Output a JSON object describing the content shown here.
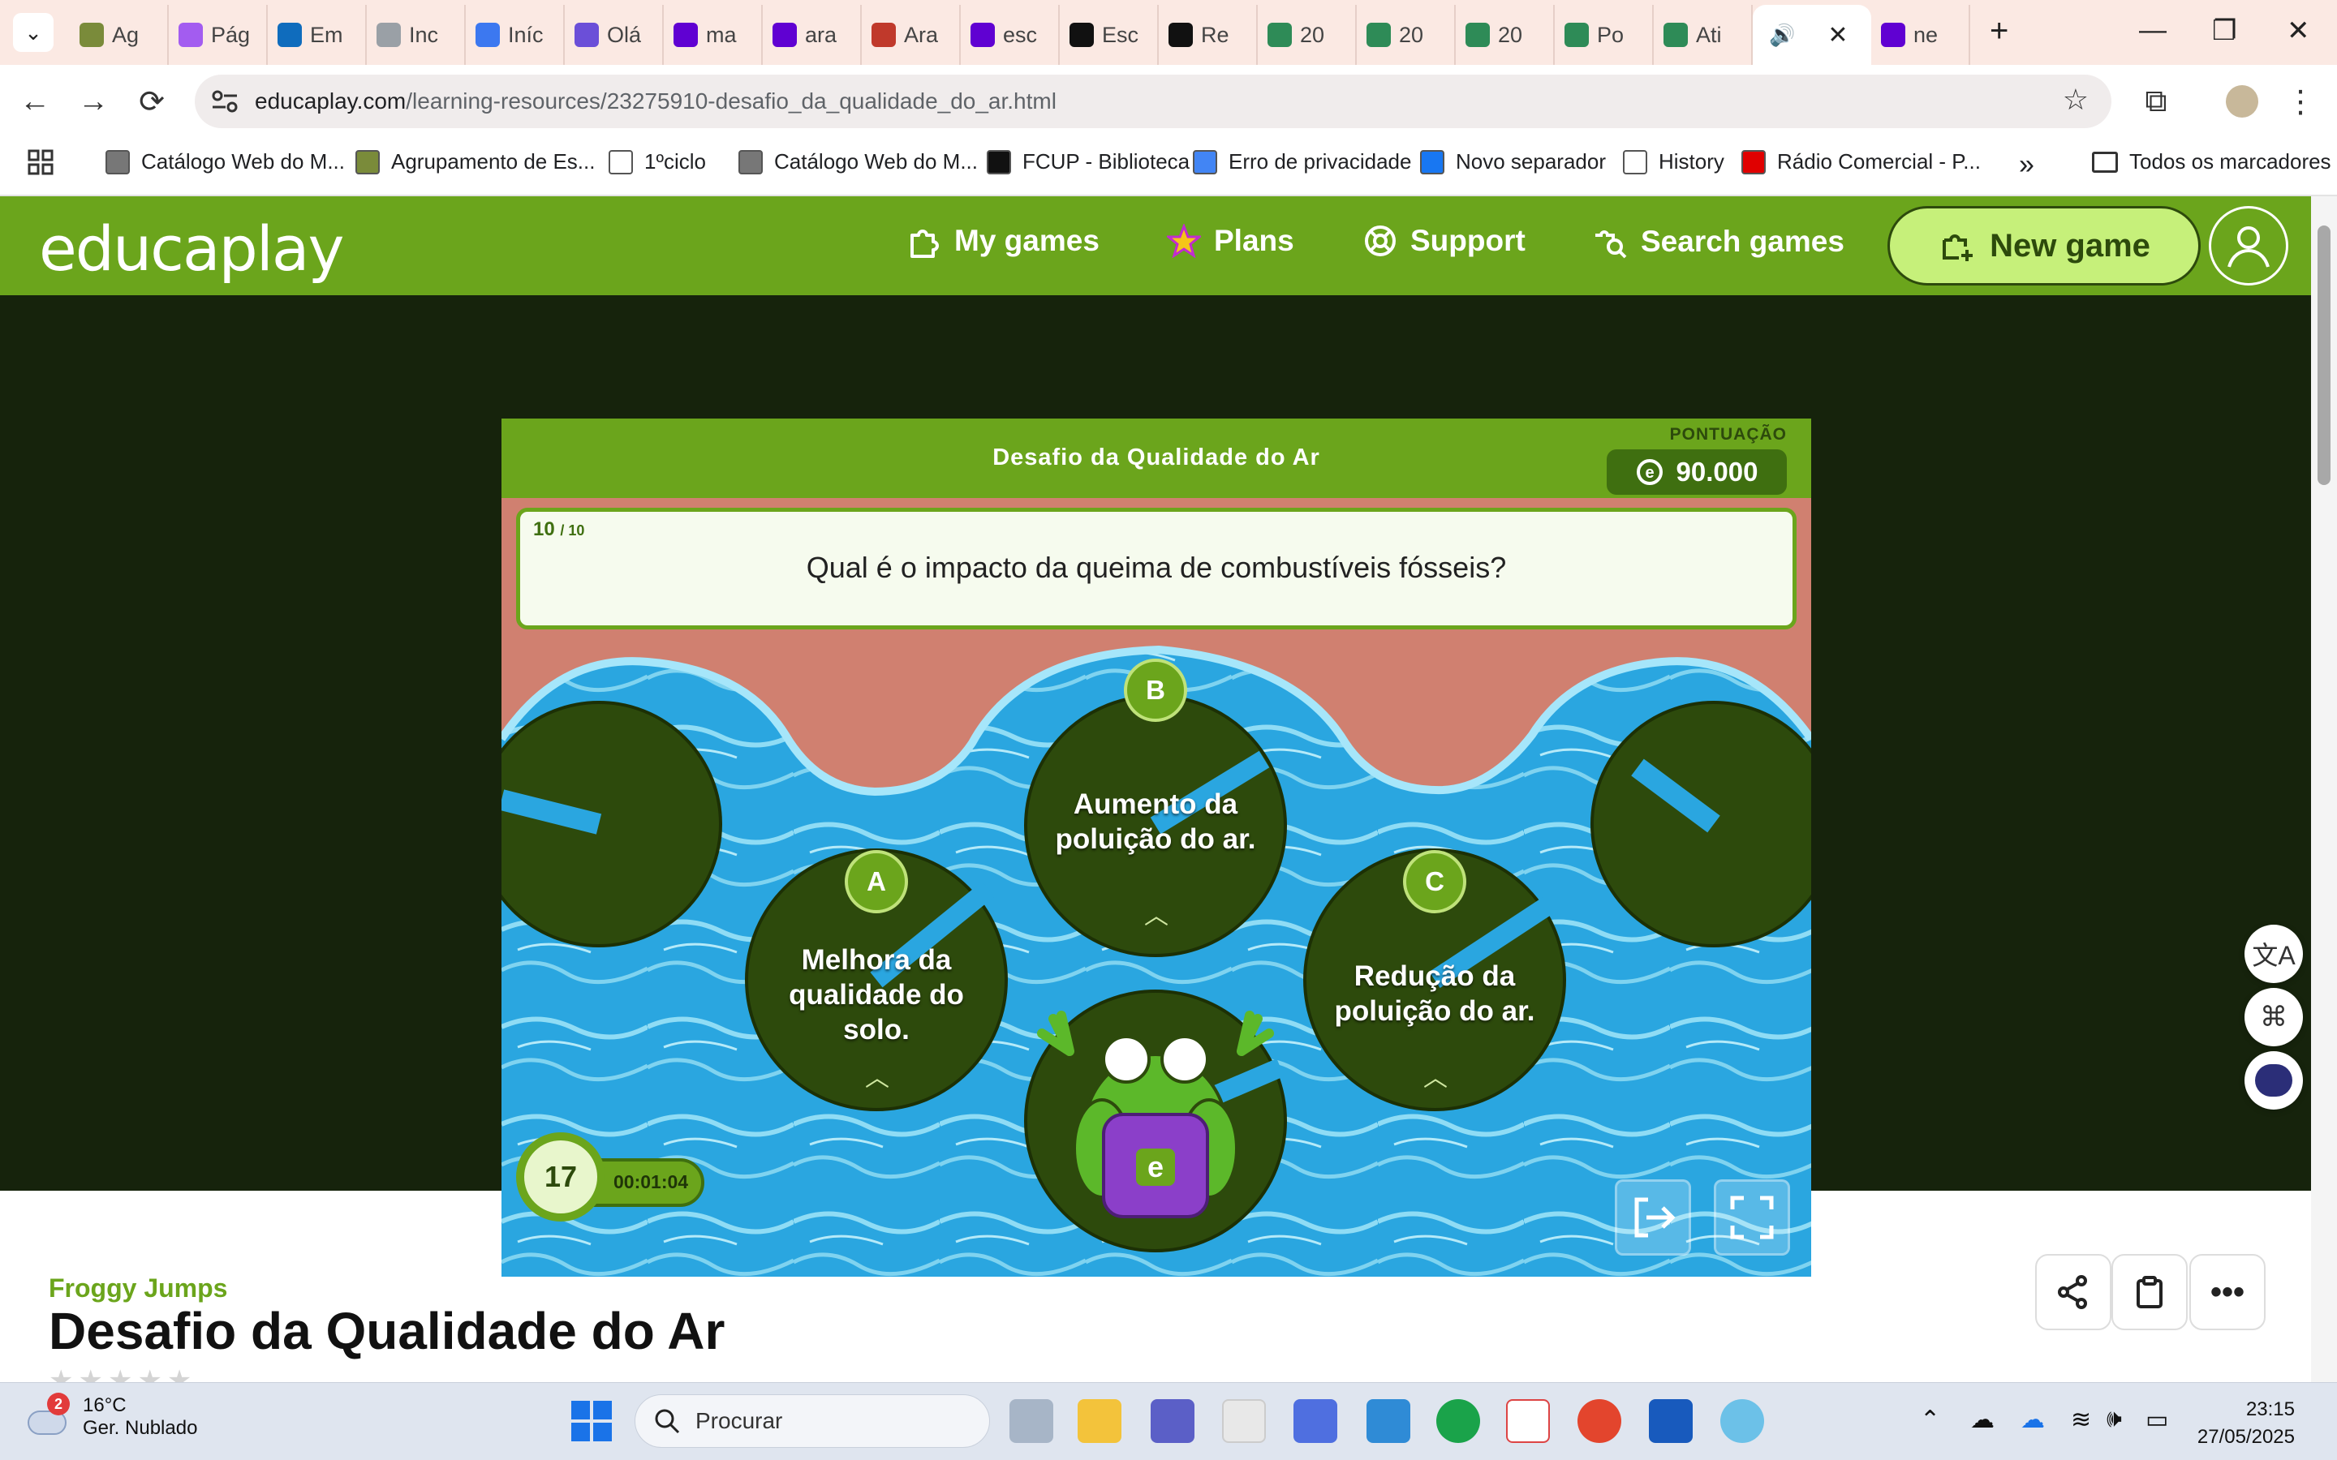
{
  "browser": {
    "tabs": [
      {
        "label": "Ag",
        "color": "#7a8b3a"
      },
      {
        "label": "Pág",
        "color": "#a35cf0"
      },
      {
        "label": "Em",
        "color": "#0f6cbd"
      },
      {
        "label": "Inc",
        "color": "#9aa0a6"
      },
      {
        "label": "Iníc",
        "color": "#3c78f0"
      },
      {
        "label": "Olá",
        "color": "#6b4fd8"
      },
      {
        "label": "ma",
        "color": "#6001d2"
      },
      {
        "label": "ara",
        "color": "#6001d2"
      },
      {
        "label": "Ara",
        "color": "#c0392b"
      },
      {
        "label": "esc",
        "color": "#6001d2"
      },
      {
        "label": "Esc",
        "color": "#111111"
      },
      {
        "label": "Re",
        "color": "#111111"
      },
      {
        "label": "20",
        "color": "#2e8b57"
      },
      {
        "label": "20",
        "color": "#2e8b57"
      },
      {
        "label": "20",
        "color": "#2e8b57"
      },
      {
        "label": "Po",
        "color": "#2e8b57"
      },
      {
        "label": "Ati",
        "color": "#2e8b57"
      },
      {
        "label": "",
        "active": true,
        "color": "#ffffff"
      },
      {
        "label": "ne",
        "color": "#6001d2"
      }
    ],
    "url_host": "educaplay.com",
    "url_path": "/learning-resources/23275910-desafio_da_qualidade_do_ar.html",
    "bookmarks": [
      {
        "label": "Catálogo Web do M...",
        "color": "#777777"
      },
      {
        "label": "Agrupamento de Es...",
        "color": "#7a8b3a"
      },
      {
        "label": "1ºciclo",
        "color": "#ffffff"
      },
      {
        "label": "Catálogo Web do M...",
        "color": "#777777"
      },
      {
        "label": "FCUP - Biblioteca",
        "color": "#111111"
      },
      {
        "label": "Erro de privacidade",
        "color": "#4285f4"
      },
      {
        "label": "Novo separador",
        "color": "#1877f2"
      },
      {
        "label": "History",
        "color": "#ffffff"
      },
      {
        "label": "Rádio Comercial - P...",
        "color": "#e00000"
      }
    ],
    "all_bookmarks": "Todos os marcadores",
    "more_bookmarks": "»"
  },
  "site": {
    "logo": "educaplay",
    "nav": {
      "my_games": "My games",
      "plans": "Plans",
      "support": "Support",
      "search_games": "Search games",
      "new_game": "New game"
    }
  },
  "game": {
    "title": "Desafio da Qualidade do Ar",
    "score_label": "PONTUAÇÃO",
    "score": "90.000",
    "question_number": "10",
    "question_total": "/ 10",
    "question": "Qual é o impacto da queima de combustíveis fósseis?",
    "answers": [
      {
        "letter": "A",
        "text": "Melhora da qualidade do solo."
      },
      {
        "letter": "B",
        "text": "Aumento da poluição do ar."
      },
      {
        "letter": "C",
        "text": "Redução da poluição do ar."
      }
    ],
    "lives": "17",
    "timer": "00:01:04",
    "colors": {
      "green": "#6ba51c",
      "dark_green": "#2d4a0c",
      "water": "#2ea8de",
      "bank": "#d08070"
    }
  },
  "below": {
    "game_type": "Froggy Jumps",
    "title": "Desafio da Qualidade do Ar",
    "stars": "★★★★★"
  },
  "taskbar": {
    "weather_temp": "16°C",
    "weather_desc": "Ger. Nublado",
    "weather_badge": "2",
    "search_placeholder": "Procurar",
    "time": "23:15",
    "date": "27/05/2025"
  }
}
